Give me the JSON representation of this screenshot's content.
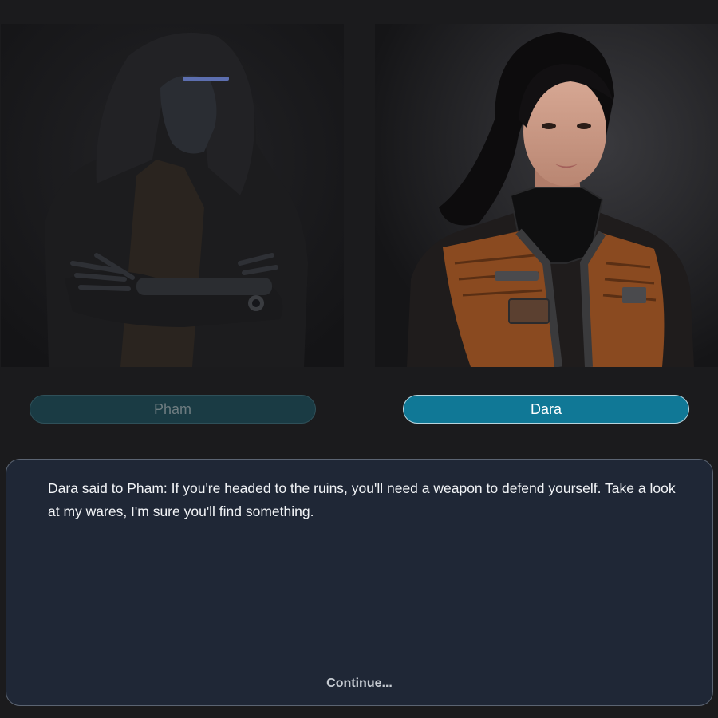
{
  "characters": {
    "left": {
      "name": "Pham",
      "state": "inactive",
      "portrait_icon": "hooded-cyborg-portrait"
    },
    "right": {
      "name": "Dara",
      "state": "active",
      "portrait_icon": "merchant-woman-portrait"
    }
  },
  "dialogue": {
    "text": "Dara said to Pham: If you're headed to the ruins, you'll need a weapon to defend yourself. Take a look at my wares, I'm sure you'll find something.",
    "continue_label": "Continue..."
  },
  "colors": {
    "background": "#1b1b1d",
    "active_button": "#107896",
    "inactive_button": "#1a3b44",
    "dialog_bg": "#1f2736",
    "dialog_border": "#5b6472"
  }
}
